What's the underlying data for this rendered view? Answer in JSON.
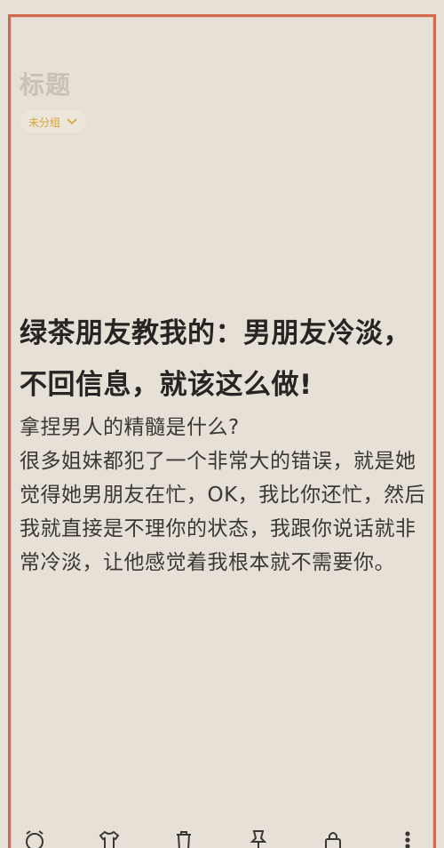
{
  "note": {
    "title_placeholder": "标题",
    "group": {
      "label": "未分组",
      "icon": "chevron-down-icon",
      "color": "#d9a43a"
    },
    "headline": "绿茶朋友教我的：男朋友冷淡，不回信息，就该这么做!",
    "paragraphs": [
      "拿捏男人的精髓是什么?",
      "很多姐妹都犯了一个非常大的错误，就是她觉得她男朋友在忙，OK，我比你还忙，然后我就直接是不理你的状态，我跟你说话就非常冷淡，让他感觉着我根本就不需要你。"
    ]
  },
  "toolbar": {
    "items": [
      {
        "name": "alarm-clock-icon"
      },
      {
        "name": "shirt-icon"
      },
      {
        "name": "trash-icon"
      },
      {
        "name": "pin-icon"
      },
      {
        "name": "lock-icon"
      },
      {
        "name": "more-vertical-icon"
      }
    ]
  },
  "colors": {
    "background": "#e6e0d6",
    "frame": "#d26a50",
    "text": "#2b2a27"
  }
}
